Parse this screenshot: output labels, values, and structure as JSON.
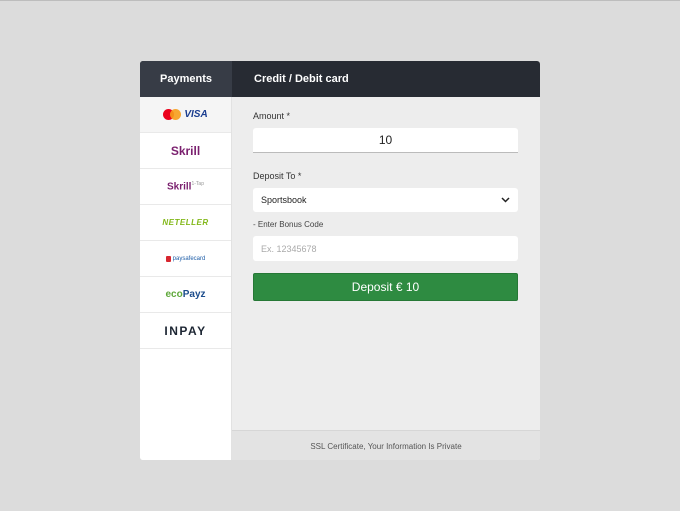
{
  "header": {
    "payments_tab": "Payments",
    "title": "Credit / Debit card"
  },
  "sidebar": {
    "methods": [
      {
        "name": "visa-mastercard",
        "label": "VISA"
      },
      {
        "name": "skrill",
        "label": "Skrill"
      },
      {
        "name": "skrill-1tap",
        "label": "Skrill",
        "suffix": "1-Tap"
      },
      {
        "name": "neteller",
        "label": "NETELLER"
      },
      {
        "name": "paysafecard",
        "label": "paysafecard"
      },
      {
        "name": "ecopayz",
        "label_a": "eco",
        "label_b": "Payz"
      },
      {
        "name": "inpay",
        "label": "INPAY"
      }
    ]
  },
  "form": {
    "amount_label": "Amount *",
    "amount_value": "10",
    "deposit_to_label": "Deposit To *",
    "deposit_to_value": "Sportsbook",
    "bonus_label": "- Enter Bonus Code",
    "bonus_placeholder": "Ex. 12345678",
    "deposit_button": "Deposit € 10"
  },
  "footer": {
    "text": "SSL Certificate, Your Information Is Private"
  },
  "colors": {
    "header_bg": "#272b33",
    "active_tab_bg": "#373c46",
    "button_green": "#2e8b41",
    "content_bg": "#ededed"
  }
}
